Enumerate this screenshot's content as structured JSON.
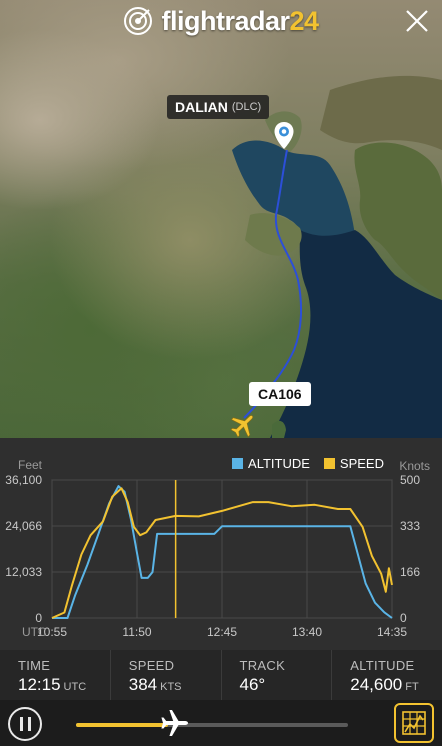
{
  "app": {
    "logo_text": "flightradar",
    "logo_accent": "24"
  },
  "icons": {
    "close": "close-icon",
    "pin": "location-pin-icon",
    "plane": "airplane-icon",
    "pause": "pause-icon",
    "map_toggle": "map-grid-icon"
  },
  "map": {
    "origin": {
      "name": "DALIAN",
      "code": "(DLC)"
    },
    "flight": {
      "callsign": "CA106"
    }
  },
  "colors": {
    "accent": "#f2c230",
    "altitude": "#5ab4e6",
    "speed": "#f2c230",
    "route": "#2c4fd8",
    "panel": "#2b2b2b"
  },
  "chart_data": {
    "type": "line",
    "left_axis_title": "Feet",
    "right_axis_title": "Knots",
    "x_unit": "UTC",
    "x_ticks": [
      "10:55",
      "11:50",
      "12:45",
      "13:40",
      "14:35"
    ],
    "y_left_ticks": [
      "36,100",
      "24,066",
      "12,033",
      "0"
    ],
    "y_right_ticks": [
      "500",
      "333",
      "166",
      "0"
    ],
    "y_left_range": [
      0,
      36100
    ],
    "y_right_range": [
      0,
      500
    ],
    "legend": [
      {
        "name": "ALTITUDE",
        "color": "#5ab4e6"
      },
      {
        "name": "SPEED",
        "color": "#f2c230"
      }
    ],
    "current_time_marker": "12:15",
    "series": [
      {
        "name": "ALTITUDE",
        "axis": "left",
        "points": [
          [
            "10:55",
            0
          ],
          [
            "11:05",
            0
          ],
          [
            "11:10",
            6000
          ],
          [
            "11:18",
            14000
          ],
          [
            "11:25",
            22000
          ],
          [
            "11:32",
            30000
          ],
          [
            "11:38",
            34500
          ],
          [
            "11:42",
            33000
          ],
          [
            "11:46",
            26000
          ],
          [
            "11:50",
            17000
          ],
          [
            "11:53",
            10500
          ],
          [
            "11:57",
            10500
          ],
          [
            "12:00",
            12000
          ],
          [
            "12:03",
            22000
          ],
          [
            "12:40",
            22000
          ],
          [
            "12:45",
            24000
          ],
          [
            "13:45",
            24000
          ],
          [
            "14:00",
            24000
          ],
          [
            "14:08",
            24000
          ],
          [
            "14:12",
            18000
          ],
          [
            "14:18",
            9000
          ],
          [
            "14:24",
            4000
          ],
          [
            "14:30",
            1500
          ],
          [
            "14:35",
            0
          ]
        ]
      },
      {
        "name": "SPEED",
        "axis": "right",
        "points": [
          [
            "10:55",
            0
          ],
          [
            "11:03",
            20
          ],
          [
            "11:08",
            120
          ],
          [
            "11:14",
            230
          ],
          [
            "11:20",
            300
          ],
          [
            "11:28",
            350
          ],
          [
            "11:34",
            440
          ],
          [
            "11:40",
            470
          ],
          [
            "11:44",
            420
          ],
          [
            "11:48",
            330
          ],
          [
            "11:52",
            300
          ],
          [
            "11:56",
            310
          ],
          [
            "12:02",
            355
          ],
          [
            "12:15",
            370
          ],
          [
            "12:30",
            368
          ],
          [
            "12:45",
            388
          ],
          [
            "13:05",
            420
          ],
          [
            "13:15",
            420
          ],
          [
            "13:30",
            405
          ],
          [
            "13:45",
            410
          ],
          [
            "14:00",
            395
          ],
          [
            "14:08",
            395
          ],
          [
            "14:16",
            330
          ],
          [
            "14:22",
            225
          ],
          [
            "14:28",
            160
          ],
          [
            "14:31",
            95
          ],
          [
            "14:33",
            180
          ],
          [
            "14:35",
            120
          ]
        ]
      }
    ]
  },
  "stats": {
    "time": {
      "label": "TIME",
      "value": "12:15",
      "unit": "UTC"
    },
    "speed": {
      "label": "SPEED",
      "value": "384",
      "unit": "KTS"
    },
    "track": {
      "label": "TRACK",
      "value": "46°",
      "unit": ""
    },
    "altitude": {
      "label": "ALTITUDE",
      "value": "24,600",
      "unit": "FT"
    }
  },
  "playback": {
    "progress": 0.34
  }
}
